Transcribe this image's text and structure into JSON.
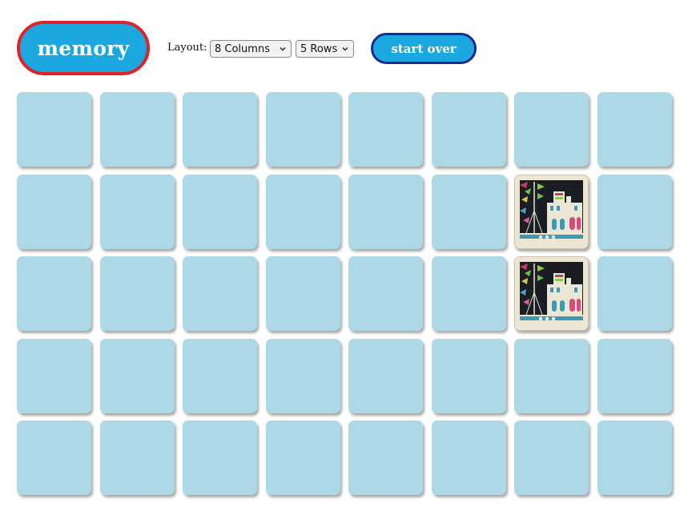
{
  "header": {
    "logo_text": "memory",
    "layout_label": "Layout:",
    "columns_select": {
      "selected": "8 Columns"
    },
    "rows_select": {
      "selected": "5 Rows"
    },
    "start_over_label": "start over"
  },
  "colors": {
    "card_back": "#add8e6",
    "button_fill": "#1ba8e0",
    "logo_border": "#e0202a",
    "start_over_border": "#1a2a8f"
  },
  "board": {
    "columns": 8,
    "rows": 5,
    "revealed_cards": [
      {
        "row": 2,
        "col": 7,
        "image": "boat-harbor-illustration"
      },
      {
        "row": 3,
        "col": 7,
        "image": "boat-harbor-illustration"
      }
    ]
  }
}
